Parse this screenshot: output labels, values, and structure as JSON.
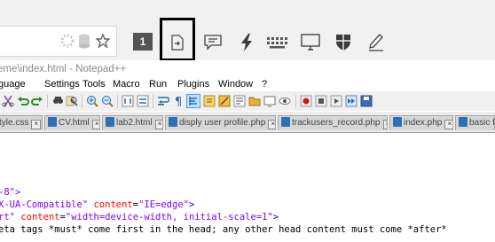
{
  "browser": {
    "tab_count": "1",
    "toolbar_icons": [
      "star-icon",
      "send-to-icon",
      "comment-icon",
      "lightning-icon",
      "keyboard-icon",
      "monitor-icon",
      "shield-icon",
      "pen-icon"
    ]
  },
  "npp": {
    "title": "eme\\index.html - Notepad++",
    "menu": [
      "guage",
      "Settings",
      "Tools",
      "Macro",
      "Run",
      "Plugins",
      "Window",
      "?"
    ],
    "tabs": [
      {
        "label": "tyle.css"
      },
      {
        "label": "CV.html"
      },
      {
        "label": "lab2.html"
      },
      {
        "label": "disply user profile.php"
      },
      {
        "label": "trackusers_record.php"
      },
      {
        "label": "index.php"
      },
      {
        "label": "basic f"
      }
    ],
    "code": {
      "l1": "-8\">",
      "l2_a": "X-UA-Compatible\"",
      "l2_b": "content",
      "l2_c": "=",
      "l2_d": "\"IE=edge\"",
      "l2_e": ">",
      "l3_a": "rt\"",
      "l3_b": "content",
      "l3_c": "=",
      "l3_d": "\"width=device-width, initial-scale=1\"",
      "l3_e": ">",
      "l4": "eta tags *must* come first in the head; any other head content must come *after*"
    }
  },
  "colors": {
    "accent_highlight": "#000000",
    "string": "#8000ff",
    "attribute": "#ff0000",
    "tag": "#0000ff"
  }
}
